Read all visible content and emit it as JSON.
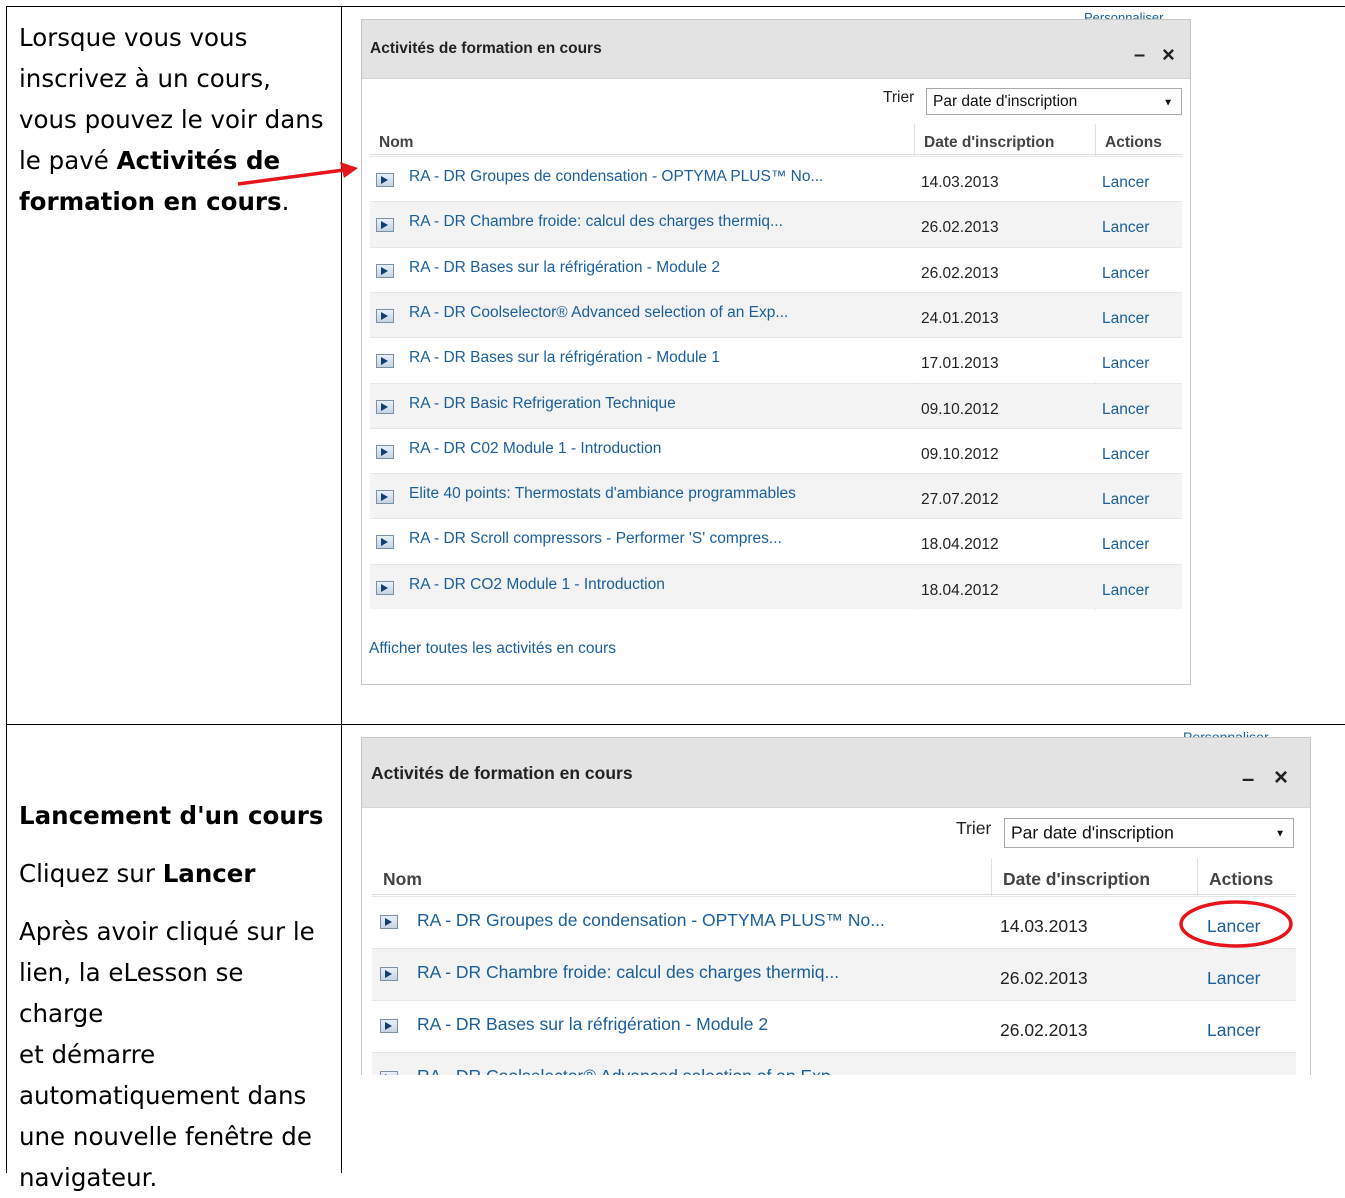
{
  "row1_text": {
    "line1": "Lorsque vous vous",
    "line2": "inscrivez à un cours,",
    "line3": "vous pouvez le voir dans",
    "line4_prefix": "le pavé ",
    "line4_bold": "Activités de",
    "line5_bold": "formation en cours",
    "line5_suffix": "."
  },
  "row2_text": {
    "heading": "Lancement d'un cours",
    "click_prefix": "Cliquez sur ",
    "click_bold": "Lancer",
    "para_lines": [
      "Après avoir cliqué sur le",
      "lien, la eLesson se charge",
      "et démarre",
      "automatiquement dans",
      "une nouvelle fenêtre de",
      "navigateur."
    ]
  },
  "widget": {
    "personalize": "Personnaliser",
    "title": "Activités de formation en cours",
    "minimize": "–",
    "close": "×",
    "sort_label": "Trier",
    "sort_value": "Par date d'inscription",
    "col_name": "Nom",
    "col_date": "Date d'inscription",
    "col_actions": "Actions",
    "footer_link": "Afficher toutes les activités en cours",
    "rows": [
      {
        "name": "RA - DR Groupes de condensation - OPTYMA PLUS™ No...",
        "date": "14.03.2013",
        "action": "Lancer"
      },
      {
        "name": "RA - DR Chambre froide: calcul des charges thermiq...",
        "date": "26.02.2013",
        "action": "Lancer"
      },
      {
        "name": "RA - DR Bases sur la réfrigération - Module 2",
        "date": "26.02.2013",
        "action": "Lancer"
      },
      {
        "name": "RA - DR Coolselector® Advanced selection of an Exp...",
        "date": "24.01.2013",
        "action": "Lancer"
      },
      {
        "name": "RA - DR Bases sur la réfrigération - Module 1",
        "date": "17.01.2013",
        "action": "Lancer"
      },
      {
        "name": "RA - DR Basic Refrigeration Technique",
        "date": "09.10.2012",
        "action": "Lancer"
      },
      {
        "name": "RA - DR C02 Module 1 - Introduction",
        "date": "09.10.2012",
        "action": "Lancer"
      },
      {
        "name": "Elite 40 points: Thermostats d'ambiance programmables",
        "date": "27.07.2012",
        "action": "Lancer"
      },
      {
        "name": "RA - DR Scroll compressors - Performer 'S' compres...",
        "date": "18.04.2012",
        "action": "Lancer"
      },
      {
        "name": "RA - DR CO2 Module 1 - Introduction",
        "date": "18.04.2012",
        "action": "Lancer"
      }
    ]
  },
  "colors": {
    "link": "#1a5f9c",
    "highlight_arrow": "#e8141c",
    "header_bg": "#e3e3e3"
  }
}
